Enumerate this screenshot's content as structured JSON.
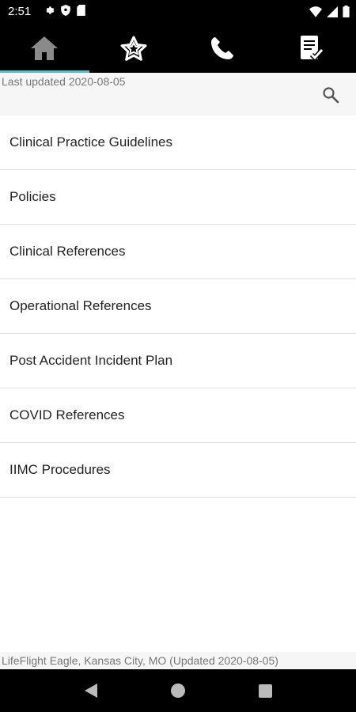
{
  "status_bar": {
    "time": "2:51",
    "left_icons": [
      "settings-icon",
      "shield-icon",
      "sd-card-icon"
    ],
    "right_icons": [
      "wifi-icon",
      "signal-icon",
      "battery-icon"
    ]
  },
  "top_nav": {
    "tabs": [
      {
        "icon": "home-icon",
        "active": true
      },
      {
        "icon": "star-icon",
        "active": false
      },
      {
        "icon": "phone-icon",
        "active": false
      },
      {
        "icon": "checklist-icon",
        "active": false
      }
    ],
    "accent_color": "#4fc3c7"
  },
  "header": {
    "last_updated": "Last updated 2020-08-05",
    "search_icon": "search-icon"
  },
  "list": {
    "items": [
      {
        "label": "Clinical Practice Guidelines"
      },
      {
        "label": "Policies"
      },
      {
        "label": "Clinical References"
      },
      {
        "label": "Operational References"
      },
      {
        "label": "Post Accident Incident Plan"
      },
      {
        "label": "COVID References"
      },
      {
        "label": "IIMC Procedures"
      }
    ]
  },
  "footer": {
    "text": "LifeFlight Eagle, Kansas City, MO (Updated 2020-08-05)"
  },
  "android_nav": {
    "buttons": [
      "back-icon",
      "home-circle-icon",
      "recents-icon"
    ]
  }
}
